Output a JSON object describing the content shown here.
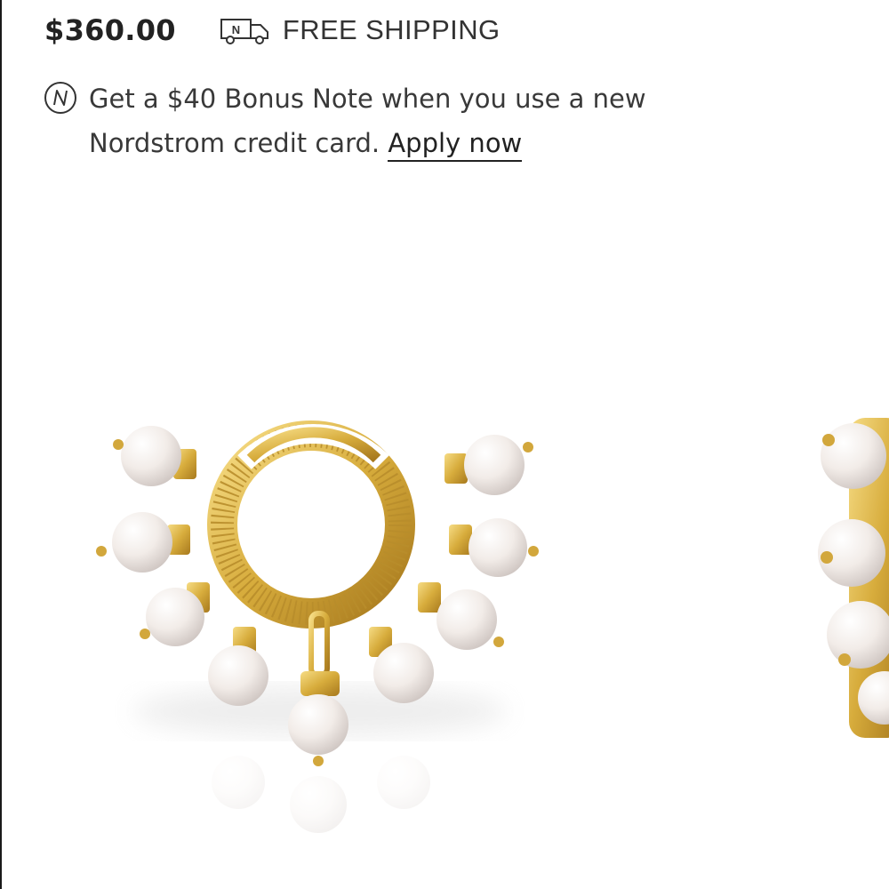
{
  "product": {
    "price": "$360.00"
  },
  "shipping": {
    "label": "FREE SHIPPING",
    "icon": "delivery-truck-icon"
  },
  "promo": {
    "icon": "nordstrom-note-icon",
    "line1": "Get a $40 Bonus Note when you use a new",
    "line2": "Nordstrom credit card.",
    "link_label": "Apply now"
  },
  "image": {
    "subject": "product-image",
    "colors": {
      "gold": "#d9b24a",
      "pearl": "#f4eee9"
    }
  }
}
